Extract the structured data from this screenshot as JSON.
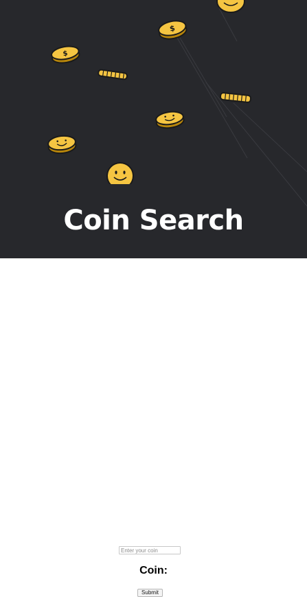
{
  "hero": {
    "title": "Coin Search",
    "background": "#27282c",
    "coin_color": "#f5c542",
    "coin_outline": "#1a1a1a"
  },
  "form": {
    "input_placeholder": "Enter your coin",
    "input_value": "",
    "result_label": "Coin:",
    "submit_label": "Submit"
  }
}
